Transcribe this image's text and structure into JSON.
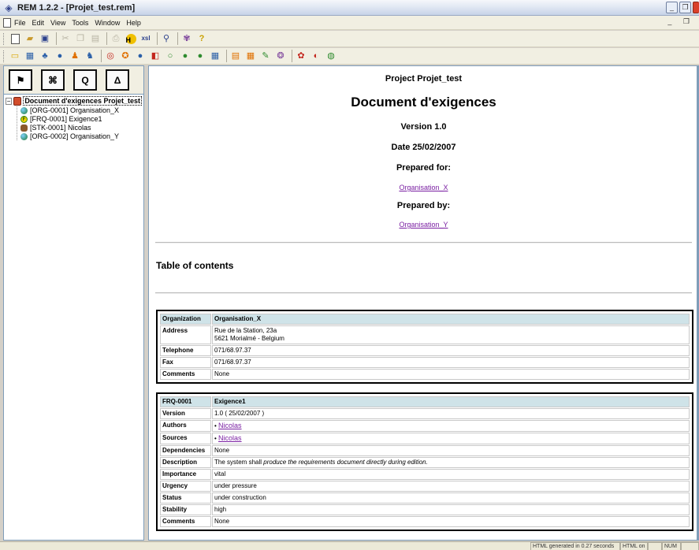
{
  "window": {
    "title": "REM 1.2.2 - [Projet_test.rem]",
    "buttons": {
      "minimize": "_",
      "restore": "❐",
      "close": ""
    }
  },
  "menubar": {
    "items": [
      "File",
      "Edit",
      "View",
      "Tools",
      "Window",
      "Help"
    ],
    "mdi_controls": "_ ❐"
  },
  "toolbar1": {
    "icons": [
      "new-document-icon",
      "open-folder-icon",
      "save-icon",
      "cut-icon",
      "copy-icon",
      "paste-icon",
      "print-icon",
      "html-icon",
      "xsl-icon",
      "zoom-icon",
      "find-icon",
      "help-icon"
    ],
    "html_glyph": "H",
    "xsl_glyph": "xsl",
    "help_glyph": "?"
  },
  "toolbar2": {
    "icons": [
      "new-project-icon",
      "properties-icon",
      "organization-icon",
      "globe-icon",
      "stakeholder-icon",
      "group-icon",
      "objective-icon",
      "actor-icon",
      "info-requirement-icon",
      "constraint-icon",
      "cycle-icon",
      "functional-requirement-icon",
      "nonfunctional-requirement-icon",
      "matrix-icon",
      "traceability-icon",
      "grid-icon",
      "edit-icon",
      "test-icon",
      "change-request-icon",
      "issue-icon",
      "defect-icon",
      "task-icon"
    ]
  },
  "left_panel": {
    "tabs": [
      {
        "name": "project-view-tab",
        "glyph": "⚑"
      },
      {
        "name": "model-view-tab",
        "glyph": "⌘"
      },
      {
        "name": "quality-view-tab",
        "glyph": "Q"
      },
      {
        "name": "delta-view-tab",
        "glyph": "Δ"
      }
    ],
    "tree": {
      "root_label": "Document d'exigences Projet_test",
      "expander": "−",
      "children": [
        {
          "label": "[ORG-0001] Organisation_X",
          "icon": "globe"
        },
        {
          "label": "[FRQ-0001] Exigence1",
          "icon": "requirement"
        },
        {
          "label": "[STK-0001] Nicolas",
          "icon": "person"
        },
        {
          "label": "[ORG-0002] Organisation_Y",
          "icon": "globe"
        }
      ]
    }
  },
  "document": {
    "project_line": "Project Projet_test",
    "title": "Document d'exigences",
    "version_line": "Version 1.0",
    "date_line": "Date 25/02/2007",
    "prepared_for_label": "Prepared for:",
    "prepared_for_link": "Organisation_X",
    "prepared_by_label": "Prepared by:",
    "prepared_by_link": "Organisation_Y",
    "toc_heading": "Table of contents",
    "organization_table": {
      "header_key": "Organization",
      "header_value": "Organisation_X",
      "rows": [
        {
          "key": "Address",
          "value_lines": [
            "Rue de la Station, 23a",
            "5621 Morialmé - Belgium"
          ]
        },
        {
          "key": "Telephone",
          "value": "071/68.97.37"
        },
        {
          "key": "Fax",
          "value": "071/68.97.37"
        },
        {
          "key": "Comments",
          "value": "None"
        }
      ]
    },
    "requirement_table": {
      "header_key": "FRQ-0001",
      "header_value": "Exigence1",
      "version_key": "Version",
      "version_value": "1.0 ( 25/02/2007 )",
      "authors_key": "Authors",
      "authors_link": "Nicolas",
      "sources_key": "Sources",
      "sources_link": "Nicolas",
      "dependencies_key": "Dependencies",
      "dependencies_value": "None",
      "description_key": "Description",
      "description_prefix": "The system shall ",
      "description_emph": "produce the requirements document directly during edition.",
      "importance_key": "Importance",
      "importance_value": "vital",
      "urgency_key": "Urgency",
      "urgency_value": "under pressure",
      "status_key": "Status",
      "status_value": "under construction",
      "stability_key": "Stability",
      "stability_value": "high",
      "comments_key": "Comments",
      "comments_value": "None"
    }
  },
  "statusbar": {
    "message": "HTML generated in 0.27 seconds",
    "mode": "HTML on",
    "empty_panel": "",
    "num": "NUM"
  }
}
